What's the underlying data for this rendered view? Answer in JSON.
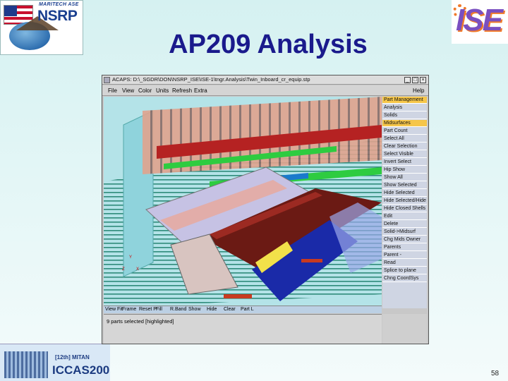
{
  "slide": {
    "title": "AP209 Analysis",
    "page_number": "58"
  },
  "logos": {
    "nsrp_subtitle": "MARITECH ASE",
    "nsrp_text": "NSRP",
    "ise_text": "ISE",
    "iccas_small": "[12th] MITAN",
    "iccas_name": "ICCAS2005"
  },
  "window": {
    "title": "ACAPS: D:\\_SGDR\\DON\\NSRP_ISE\\ISE-1\\tngr.Analysis\\Twin_Inboard_cr_equip.stp",
    "minimize": "_",
    "maximize": "□",
    "close": "×"
  },
  "menu": {
    "file": "File",
    "view": "View",
    "color": "Color",
    "units": "Units",
    "refresh": "Refresh",
    "extra": "Extra",
    "help": "Help"
  },
  "side_panel": {
    "items": [
      "Part Management",
      "Analysis",
      "Solids",
      "Midsurfaces",
      "Part Count",
      "Select All",
      "Clear Selection",
      "Select Visible",
      "Invert Select",
      "Hip Show",
      "Show All",
      "Show Selected",
      "Hide Selected",
      "Hide Selected/Hide",
      "Hide Closed Shells",
      "Edit",
      "Delete",
      "Solid->Midsurf",
      "Chg Mids Owner",
      "Parents",
      "Parent -",
      "Read",
      "Splice to plane",
      "Chng CoordSys"
    ],
    "active_indices": [
      0,
      3
    ]
  },
  "toolbar": {
    "buttons": [
      "View Fit",
      "Frame",
      "Reset P",
      "Fill",
      "R.Band",
      "Show",
      "Hide",
      "Clear",
      "Part L"
    ]
  },
  "status": {
    "message": "9 parts selected [highlighted]"
  },
  "axes": {
    "y": "Y",
    "z": "Z",
    "x": "X"
  },
  "colors": {
    "title": "#1a1a8c",
    "viewport_bg": "#b4e3e8",
    "highlight": "#f6c64a",
    "deck_red": "#6b1a14",
    "hull_blue": "#1a2aa8"
  }
}
